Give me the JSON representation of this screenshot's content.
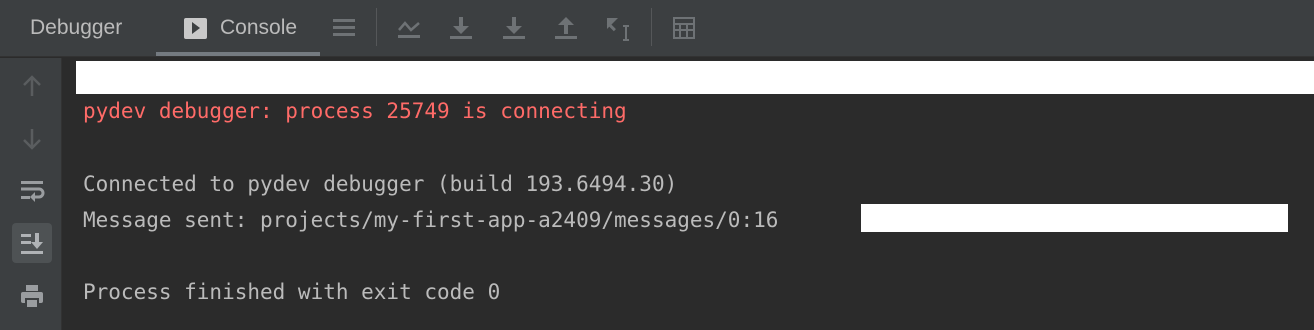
{
  "tabs": {
    "debugger_label": "Debugger",
    "console_label": "Console"
  },
  "toolbar": {
    "icons": [
      "menu-icon",
      "show-execution-point-icon",
      "step-over-icon",
      "step-into-icon",
      "step-out-icon",
      "run-to-cursor-icon",
      "evaluate-expression-icon"
    ]
  },
  "sidebar": {
    "icons": [
      "up-arrow-icon",
      "down-arrow-icon",
      "soft-wrap-icon",
      "scroll-to-end-icon",
      "print-icon"
    ]
  },
  "console": {
    "line_error": "pydev debugger: process 25749 is connecting",
    "line_connected": "Connected to pydev debugger (build 193.6494.30)",
    "line_message": "Message sent: projects/my-first-app-a2409/messages/0:16",
    "line_finished": "Process finished with exit code 0"
  },
  "colors": {
    "background": "#2b2b2b",
    "panel": "#3c3f41",
    "text": "#bbbbbb",
    "error_text": "#ff6b68"
  }
}
